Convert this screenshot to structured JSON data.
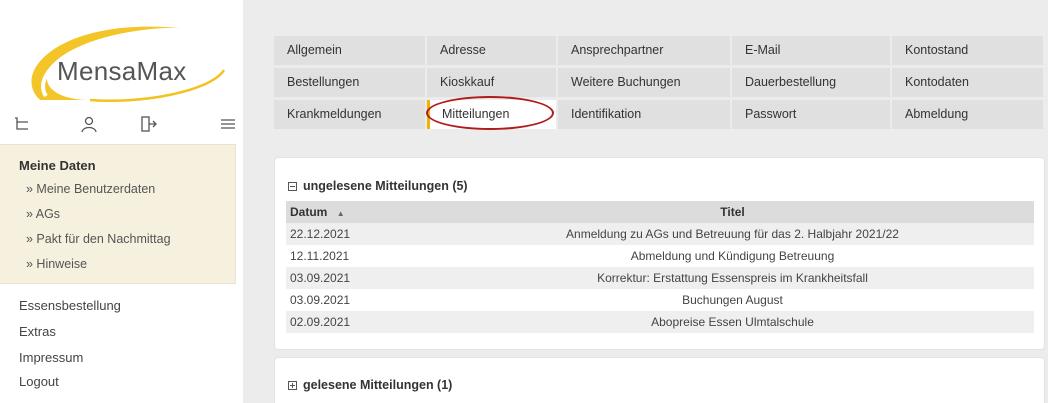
{
  "app": {
    "logo_text": "MensaMax"
  },
  "toolbar_icons": [
    {
      "name": "cart-icon"
    },
    {
      "name": "user-icon"
    },
    {
      "name": "logout-icon"
    },
    {
      "name": "hamburger-menu-icon"
    }
  ],
  "sidebar": {
    "section_title": "Meine Daten",
    "items": [
      {
        "label": "» Meine Benutzerdaten"
      },
      {
        "label": "» AGs"
      },
      {
        "label": "» Pakt für den Nachmittag"
      },
      {
        "label": "» Hinweise"
      }
    ],
    "links": [
      {
        "label": "Essensbestellung"
      },
      {
        "label": "Extras"
      },
      {
        "label": "Impressum"
      },
      {
        "label": "Logout"
      }
    ]
  },
  "tabs": {
    "row1": [
      "Allgemein",
      "Adresse",
      "Ansprechpartner",
      "E-Mail",
      "Kontostand"
    ],
    "row2": [
      "Bestellungen",
      "Kioskkauf",
      "Weitere Buchungen",
      "Dauerbestellung",
      "Kontodaten"
    ],
    "row3": [
      "Krankmeldungen",
      "Mitteilungen",
      "Identifikation",
      "Passwort",
      "Abmeldung"
    ],
    "active": "Mitteilungen"
  },
  "unread": {
    "heading": "ungelesene Mitteilungen (5)",
    "col_date": "Datum",
    "sort_indicator": "▲",
    "col_title": "Titel",
    "rows": [
      {
        "date": "22.12.2021",
        "title": "Anmeldung zu AGs und Betreuung für das 2. Halbjahr 2021/22"
      },
      {
        "date": "12.11.2021",
        "title": "Abmeldung und Kündigung Betreuung"
      },
      {
        "date": "03.09.2021",
        "title": "Korrektur: Erstattung Essenspreis im Krankheitsfall"
      },
      {
        "date": "03.09.2021",
        "title": "Buchungen August"
      },
      {
        "date": "02.09.2021",
        "title": "Abopreise Essen Ulmtalschule"
      }
    ]
  },
  "read": {
    "heading": "gelesene Mitteilungen (1)"
  },
  "colors": {
    "accent_active_tab": "#f0b400",
    "annotation_oval": "#b01c1c",
    "logo_swoosh": "#f3c21c",
    "sidebar_box": "#f6f0df"
  }
}
